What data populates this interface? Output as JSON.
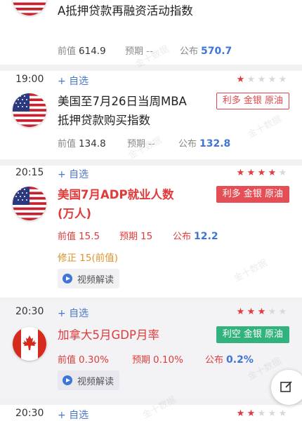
{
  "events": [
    {
      "time": "",
      "title": "A抵押贷款再融资活动指数",
      "title_color": "#222222",
      "prev_label": "前值",
      "prev": "614.9",
      "forecast_label": "预期",
      "forecast": "--",
      "actual_label": "公布",
      "actual": "570.7"
    },
    {
      "time": "19:00",
      "add_label": "+ 自选",
      "stars": 1,
      "title": "美国至7月26日当周MBA抵押贷款购买指数",
      "tag": "利多 金银 原油",
      "prev_label": "前值",
      "prev": "134.8",
      "forecast_label": "预期",
      "forecast": "--",
      "actual_label": "公布",
      "actual": "132.8"
    },
    {
      "time": "20:15",
      "add_label": "+ 自选",
      "stars": 4,
      "title": "美国7月ADP就业人数(万人)",
      "tag": "利多 金银 原油",
      "prev_label": "前值",
      "prev": "15.5",
      "forecast_label": "预期",
      "forecast": "15",
      "actual_label": "公布",
      "actual": "12.2",
      "revise": "修正 15(前值)",
      "video": "视频解读"
    },
    {
      "time": "20:30",
      "add_label": "+ 自选",
      "stars": 3,
      "title": "加拿大5月GDP月率",
      "tag": "利空 金银 原油",
      "prev_label": "前值",
      "prev": "0.30%",
      "forecast_label": "预期",
      "forecast": "0.10%",
      "actual_label": "公布",
      "actual": "0.2%",
      "video": "视频解读"
    },
    {
      "time": "20:30",
      "add_label": "+ 自选",
      "stars": 2
    }
  ],
  "watermark": "金十数据",
  "colors": {
    "star_on": "#e0393e",
    "star_off": "#d8d8d8",
    "actual_blue": "#3f74d8",
    "bullish_red": "#e54e55",
    "bearish_green": "#32b27d",
    "revise_orange": "#e0932a"
  }
}
